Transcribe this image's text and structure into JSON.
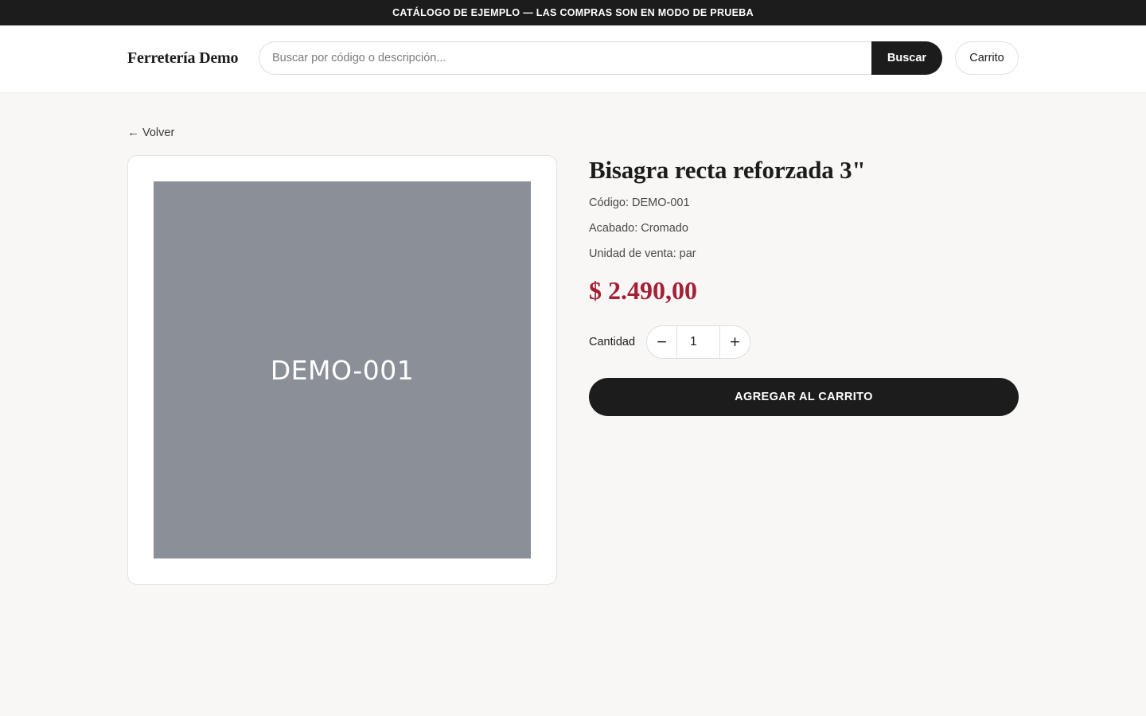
{
  "announcement": "CATÁLOGO DE EJEMPLO — LAS COMPRAS SON EN MODO DE PRUEBA",
  "header": {
    "brand": "Ferretería Demo",
    "search_placeholder": "Buscar por código o descripción...",
    "search_value": "",
    "search_button": "Buscar",
    "cart_button": "Carrito"
  },
  "nav": {
    "back_arrow": "←",
    "back_label": "Volver"
  },
  "product": {
    "image_label": "DEMO-001",
    "image_color": "#8a8f98",
    "title": "Bisagra recta reforzada 3\"",
    "code": "Código: DEMO-001",
    "finish": "Acabado: Cromado",
    "unit": "Unidad de venta: par",
    "price": "$ 2.490,00",
    "price_color": "#a51f35"
  },
  "quantity": {
    "label": "Cantidad",
    "decrement": "−",
    "value": "1",
    "increment": "+"
  },
  "add_to_cart": "AGREGAR AL CARRITO"
}
